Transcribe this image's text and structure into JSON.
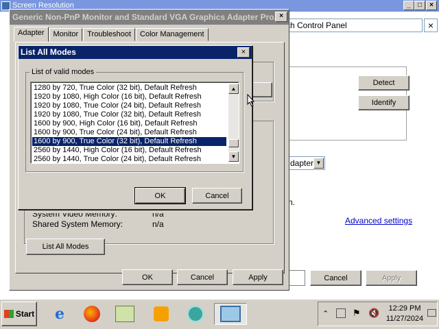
{
  "background_window": {
    "title": "Screen Resolution",
    "address_text": "rch Control Panel",
    "detect_label": "Detect",
    "identify_label": "Identify",
    "adapter_select_value": "dapter",
    "partial_text": "n.",
    "advanced_settings_link": "Advanced settings",
    "cancel_label": "Cancel",
    "apply_label": "Apply"
  },
  "properties_dialog": {
    "title": "Generic Non-PnP Monitor and Standard VGA Graphics Adapter Pro...",
    "tabs": [
      {
        "label": "Adapter"
      },
      {
        "label": "Monitor"
      },
      {
        "label": "Troubleshoot"
      },
      {
        "label": "Color Management"
      }
    ],
    "partial_row_label": "System Video Memory:",
    "partial_row_value": "n/a",
    "shared_memory_label": "Shared System Memory:",
    "shared_memory_value": "n/a",
    "list_all_modes_label": "List All Modes",
    "ok_label": "OK",
    "cancel_label": "Cancel",
    "apply_label": "Apply"
  },
  "modes_dialog": {
    "title": "List All Modes",
    "group_label": "List of valid modes",
    "modes": [
      "1280 by 720, True Color (32 bit), Default Refresh",
      "1920 by 1080, High Color (16 bit), Default Refresh",
      "1920 by 1080, True Color (24 bit), Default Refresh",
      "1920 by 1080, True Color (32 bit), Default Refresh",
      "1600 by 900, High Color (16 bit), Default Refresh",
      "1600 by 900, True Color (24 bit), Default Refresh",
      "1600 by 900, True Color (32 bit), Default Refresh",
      "2560 by 1440, High Color (16 bit), Default Refresh",
      "2560 by 1440, True Color (24 bit), Default Refresh"
    ],
    "selected_index": 6,
    "ok_label": "OK",
    "cancel_label": "Cancel"
  },
  "taskbar": {
    "start_label": "Start",
    "apps": [
      "internet-explorer-icon",
      "firefox-icon",
      "control-panel-icon",
      "media-player-icon",
      "app-icon",
      "screen-resolution-icon"
    ],
    "clock_time": "12:29 PM",
    "clock_date": "11/27/2024"
  },
  "colors": {
    "active_title": "#0a246a",
    "inactive_title": "#808080",
    "face": "#d4d0c8",
    "link": "#0000cc"
  }
}
